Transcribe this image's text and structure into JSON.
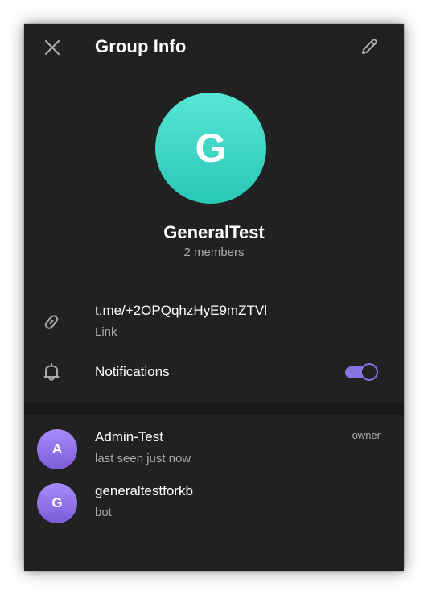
{
  "header": {
    "title": "Group Info",
    "close_icon": "close-icon",
    "edit_icon": "pencil-icon"
  },
  "group": {
    "avatar_letter": "G",
    "name": "GeneralTest",
    "members_text": "2 members"
  },
  "info": {
    "link_value": "t.me/+2OPQqhzHyE9mZTVl",
    "link_caption": "Link",
    "link_icon": "link-icon",
    "notifications_label": "Notifications",
    "notifications_icon": "bell-icon",
    "notifications_enabled": true
  },
  "members": [
    {
      "avatar_letter": "A",
      "name": "Admin-Test",
      "status": "last seen just now",
      "role": "owner"
    },
    {
      "avatar_letter": "G",
      "name": "generaltestforkb",
      "status": "bot",
      "role": ""
    }
  ],
  "colors": {
    "background": "#212121",
    "accent": "#8774e1",
    "group_avatar_gradient": [
      "#57e6d4",
      "#28c7b6"
    ],
    "member_avatar_gradient": [
      "#a78bfa",
      "#7c5cd9"
    ],
    "secondary_text": "#aaaaaa"
  }
}
